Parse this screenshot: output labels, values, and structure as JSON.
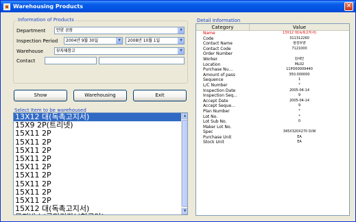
{
  "window": {
    "title": "Warehousing Products"
  },
  "info": {
    "title": "Information of Products",
    "department_label": "Department",
    "department_value": "안양 공장",
    "period_label": "Inspection Period",
    "period_from": "2004년  9월 30일",
    "period_to": "2008년 10월  1일",
    "warehouse_label": "Warehouse",
    "warehouse_value": "부자재창고",
    "contact_label": "Contact",
    "contact_value": ""
  },
  "buttons": {
    "show": "Show",
    "warehousing": "Warehousing",
    "exit": "Exit"
  },
  "list": {
    "label": "Select Item to be warehoused",
    "items": [
      "13X12 대(독촉고지서)",
      "15X9  2P(트리넷)",
      "15X11 2P",
      "15X11 2P",
      "15X11 2P",
      "15X11 2P",
      "15X11 2P",
      "15X11 2P",
      "15X11 2P",
      "15X11 2P",
      "15X11 2P",
      "15X12 대(독촉고지서)",
      "무지박스(국민건강보험공단)"
    ]
  },
  "detail": {
    "title": "Detail Information",
    "col_category": "Category",
    "col_value": "Value",
    "rows": [
      {
        "category": "Name",
        "value": "13X12 대(독촉고지서)"
      },
      {
        "category": "Code",
        "value": "311312260"
      },
      {
        "category": "Contact Name",
        "value": "삼성유양"
      },
      {
        "category": "Contact Code",
        "value": "7121000"
      },
      {
        "category": "Order Number",
        "value": ""
      },
      {
        "category": "Worker",
        "value": "김세인"
      },
      {
        "category": "Location",
        "value": "ML02"
      },
      {
        "category": "Purchase Nu...",
        "value": "11PO00009440"
      },
      {
        "category": "Amount of pass",
        "value": "350.000000"
      },
      {
        "category": "Sequence",
        "value": "1"
      },
      {
        "category": "L/C Number",
        "value": "*"
      },
      {
        "category": "Inspection Date",
        "value": "2005-04-14"
      },
      {
        "category": "Inspection Seq...",
        "value": "9"
      },
      {
        "category": "Accept Date",
        "value": "2005-04-14"
      },
      {
        "category": "Accept Seque...",
        "value": "9"
      },
      {
        "category": "Plan Number",
        "value": "*"
      },
      {
        "category": "Lot No.",
        "value": "*"
      },
      {
        "category": "Lot Sub No.",
        "value": "0"
      },
      {
        "category": "Maker Lot No.",
        "value": ""
      },
      {
        "category": "Spec",
        "value": "345X320X270  D/W"
      },
      {
        "category": "Purchase Unit",
        "value": "EA"
      },
      {
        "category": "Stock Unit",
        "value": "EA"
      }
    ]
  }
}
